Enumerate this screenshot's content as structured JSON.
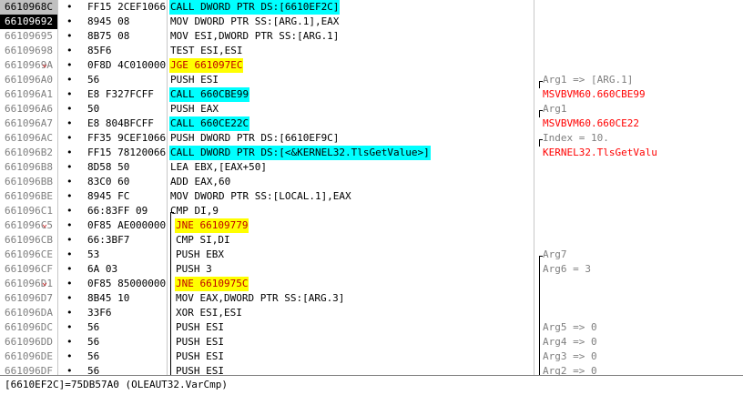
{
  "rows": [
    {
      "addr": "6610968C",
      "dot": "•",
      "hex": "FF15 2CEF1066",
      "ins": "CALL DWORD PTR DS:[6610EF2C]",
      "ins_type": "call",
      "com": ""
    },
    {
      "addr": "66109692",
      "dot": "•",
      "hex": "8945 08",
      "ins": "MOV DWORD PTR SS:[ARG.1],EAX",
      "ins_type": "",
      "com": ""
    },
    {
      "addr": "66109695",
      "dot": "•",
      "hex": "8B75 08",
      "ins": "MOV ESI,DWORD PTR SS:[ARG.1]",
      "ins_type": "",
      "com": ""
    },
    {
      "addr": "66109698",
      "dot": "•",
      "hex": "85F6",
      "ins": "TEST ESI,ESI",
      "ins_type": "",
      "com": ""
    },
    {
      "addr": "6610969A",
      "dot": "•",
      "hex": "0F8D 4C010000",
      "ins": "JGE 661097EC",
      "ins_type": "jmp",
      "com": "",
      "mark": "⌄"
    },
    {
      "addr": "661096A0",
      "dot": "•",
      "hex": "56",
      "ins": "PUSH ESI",
      "ins_type": "",
      "com": "Arg1 => [ARG.1]",
      "com_color": "gray",
      "com_black": true
    },
    {
      "addr": "661096A1",
      "dot": "•",
      "hex": "E8 F327FCFF",
      "ins": "CALL 660CBE99",
      "ins_type": "call",
      "com": "MSVBVM60.660CBE99",
      "com_color": "red"
    },
    {
      "addr": "661096A6",
      "dot": "•",
      "hex": "50",
      "ins": "PUSH EAX",
      "ins_type": "",
      "com": "Arg1",
      "com_color": "gray"
    },
    {
      "addr": "661096A7",
      "dot": "•",
      "hex": "E8 804BFCFF",
      "ins": "CALL 660CE22C",
      "ins_type": "call",
      "com": "MSVBVM60.660CE22",
      "com_color": "red"
    },
    {
      "addr": "661096AC",
      "dot": "•",
      "hex": "FF35 9CEF1066",
      "ins": "PUSH DWORD PTR DS:[6610EF9C]",
      "ins_type": "",
      "com": "Index = 10.",
      "com_color": "gray"
    },
    {
      "addr": "661096B2",
      "dot": "•",
      "hex": "FF15 78120066",
      "ins": "CALL DWORD PTR DS:[<&KERNEL32.TlsGetValue>]",
      "ins_type": "call",
      "com": "KERNEL32.TlsGetValu",
      "com_color": "red"
    },
    {
      "addr": "661096B8",
      "dot": "•",
      "hex": "8D58 50",
      "ins": "LEA EBX,[EAX+50]",
      "ins_type": "",
      "com": ""
    },
    {
      "addr": "661096BB",
      "dot": "•",
      "hex": "83C0 60",
      "ins": "ADD EAX,60",
      "ins_type": "",
      "com": ""
    },
    {
      "addr": "661096BE",
      "dot": "•",
      "hex": "8945 FC",
      "ins": "MOV DWORD PTR SS:[LOCAL.1],EAX",
      "ins_type": "",
      "com": ""
    },
    {
      "addr": "661096C1",
      "dot": "•",
      "hex": "66:83FF 09",
      "ins": "CMP DI,9",
      "ins_type": "",
      "com": ""
    },
    {
      "addr": "661096C5",
      "dot": "•",
      "hex": "0F85 AE000000",
      "ins": "JNE 66109779",
      "ins_type": "jmp",
      "com": "",
      "mark": "⌄",
      "indent": true
    },
    {
      "addr": "661096CB",
      "dot": "•",
      "hex": "66:3BF7",
      "ins": "CMP SI,DI",
      "ins_type": "",
      "com": "",
      "indent": true
    },
    {
      "addr": "661096CE",
      "dot": "•",
      "hex": "53",
      "ins": "PUSH EBX",
      "ins_type": "",
      "com": "Arg7",
      "com_color": "gray",
      "indent": true
    },
    {
      "addr": "661096CF",
      "dot": "•",
      "hex": "6A 03",
      "ins": "PUSH 3",
      "ins_type": "",
      "com": "Arg6 = 3",
      "com_color": "gray",
      "indent": true
    },
    {
      "addr": "661096D1",
      "dot": "•",
      "hex": "0F85 85000000",
      "ins": "JNE 6610975C",
      "ins_type": "jmp",
      "com": "",
      "mark": "⌄",
      "indent": true
    },
    {
      "addr": "661096D7",
      "dot": "•",
      "hex": "8B45 10",
      "ins": "MOV EAX,DWORD PTR SS:[ARG.3]",
      "ins_type": "",
      "com": "",
      "indent": true
    },
    {
      "addr": "661096DA",
      "dot": "•",
      "hex": "33F6",
      "ins": "XOR ESI,ESI",
      "ins_type": "",
      "com": "",
      "indent": true
    },
    {
      "addr": "661096DC",
      "dot": "•",
      "hex": "56",
      "ins": "PUSH ESI",
      "ins_type": "",
      "com": "Arg5 => 0",
      "com_color": "gray",
      "indent": true
    },
    {
      "addr": "661096DD",
      "dot": "•",
      "hex": "56",
      "ins": "PUSH ESI",
      "ins_type": "",
      "com": "Arg4 => 0",
      "com_color": "gray",
      "indent": true
    },
    {
      "addr": "661096DE",
      "dot": "•",
      "hex": "56",
      "ins": "PUSH ESI",
      "ins_type": "",
      "com": "Arg3 => 0",
      "com_color": "gray",
      "indent": true
    },
    {
      "addr": "661096DF",
      "dot": "•",
      "hex": "56",
      "ins": "PUSH ESI",
      "ins_type": "",
      "com": "Arg2 => 0",
      "com_color": "gray",
      "indent": true
    }
  ],
  "status": "[6610EF2C]=75DB57A0 (OLEAUT32.VarCmp)",
  "colors": {
    "call": "#00ffff",
    "jump": "#ffff00",
    "api_comment": "#ff0000",
    "selection": "#000000"
  }
}
